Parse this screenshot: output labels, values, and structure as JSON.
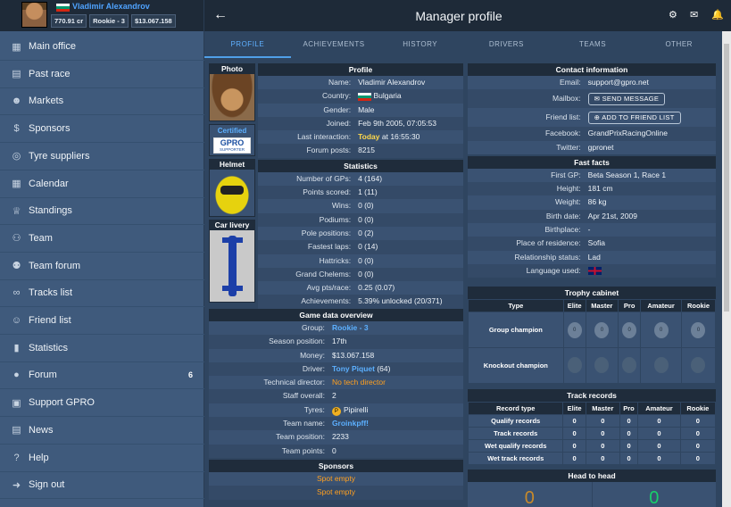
{
  "user": {
    "name": "Vladimir Alexandrov",
    "credits": "770.91 cr",
    "group": "Rookie - 3",
    "money": "$13.067.158"
  },
  "sidebar": {
    "items": [
      {
        "label": "Main office",
        "icon": "building-icon"
      },
      {
        "label": "Past race",
        "icon": "newspaper-icon"
      },
      {
        "label": "Markets",
        "icon": "users-icon"
      },
      {
        "label": "Sponsors",
        "icon": "dollar-icon"
      },
      {
        "label": "Tyre suppliers",
        "icon": "tyre-icon"
      },
      {
        "label": "Calendar",
        "icon": "calendar-icon"
      },
      {
        "label": "Standings",
        "icon": "trophy-icon"
      },
      {
        "label": "Team",
        "icon": "team-icon"
      },
      {
        "label": "Team forum",
        "icon": "team-forum-icon"
      },
      {
        "label": "Tracks list",
        "icon": "track-icon"
      },
      {
        "label": "Friend list",
        "icon": "friends-icon"
      },
      {
        "label": "Statistics",
        "icon": "bar-chart-icon"
      },
      {
        "label": "Forum",
        "icon": "forum-icon",
        "count": "6"
      },
      {
        "label": "Support GPRO",
        "icon": "support-icon"
      },
      {
        "label": "News",
        "icon": "news-icon"
      },
      {
        "label": "Help",
        "icon": "help-icon"
      },
      {
        "label": "Sign out",
        "icon": "signout-icon"
      }
    ]
  },
  "header": {
    "title": "Manager profile"
  },
  "tabs": [
    "PROFILE",
    "ACHIEVEMENTS",
    "HISTORY",
    "DRIVERS",
    "TEAMS",
    "OTHER"
  ],
  "photos": {
    "photo_label": "Photo",
    "certified": "Certified",
    "supporter": "GPRO",
    "supporter_sub": "SUPPORTER",
    "helmet_label": "Helmet",
    "livery_label": "Car livery"
  },
  "profile": {
    "title": "Profile",
    "rows": [
      {
        "label": "Name:",
        "value": "Vladimir Alexandrov"
      },
      {
        "label": "Country:",
        "value": "Bulgaria"
      },
      {
        "label": "Gender:",
        "value": "Male"
      },
      {
        "label": "Joined:",
        "value": "Feb 9th 2005, 07:05:53"
      },
      {
        "label": "Last interaction:",
        "value": "Today",
        "value2": "at 16:55:30"
      },
      {
        "label": "Forum posts:",
        "value": "8215"
      }
    ]
  },
  "statistics": {
    "title": "Statistics",
    "rows": [
      {
        "label": "Number of GPs:",
        "value": "4 (164)"
      },
      {
        "label": "Points scored:",
        "value": "1 (11)"
      },
      {
        "label": "Wins:",
        "value": "0 (0)"
      },
      {
        "label": "Podiums:",
        "value": "0 (0)"
      },
      {
        "label": "Pole positions:",
        "value": "0 (2)"
      },
      {
        "label": "Fastest laps:",
        "value": "0 (14)"
      },
      {
        "label": "Hattricks:",
        "value": "0 (0)"
      },
      {
        "label": "Grand Chelems:",
        "value": "0 (0)"
      },
      {
        "label": "Avg pts/race:",
        "value": "0.25 (0.07)"
      },
      {
        "label": "Achievements:",
        "value": "5.39% unlocked (20/371)"
      }
    ]
  },
  "game": {
    "title": "Game data overview",
    "rows": [
      {
        "label": "Group:",
        "value": "Rookie - 3"
      },
      {
        "label": "Season position:",
        "value": "17th"
      },
      {
        "label": "Money:",
        "value": "$13.067.158"
      },
      {
        "label": "Driver:",
        "value": "Tony Piquet",
        "value2": "(64)"
      },
      {
        "label": "Technical director:",
        "value": "No tech director"
      },
      {
        "label": "Staff overall:",
        "value": "2"
      },
      {
        "label": "Tyres:",
        "value": "Pipirelli"
      },
      {
        "label": "Team name:",
        "value": "Groinkpff!"
      },
      {
        "label": "Team position:",
        "value": "2233"
      },
      {
        "label": "Team points:",
        "value": "0"
      }
    ]
  },
  "sponsors": {
    "title": "Sponsors",
    "items": [
      "Spot empty",
      "Spot empty"
    ]
  },
  "contact": {
    "title": "Contact information",
    "email_label": "Email:",
    "email": "support@gpro.net",
    "mailbox_label": "Mailbox:",
    "send_message": "SEND MESSAGE",
    "friend_label": "Friend list:",
    "add_friend": "ADD TO FRIEND LIST",
    "facebook_label": "Facebook:",
    "facebook": "GrandPrixRacingOnline",
    "twitter_label": "Twitter:",
    "twitter": "gpronet"
  },
  "facts": {
    "title": "Fast facts",
    "rows": [
      {
        "label": "First GP:",
        "value": "Beta Season 1, Race 1"
      },
      {
        "label": "Height:",
        "value": "181 cm"
      },
      {
        "label": "Weight:",
        "value": "86 kg"
      },
      {
        "label": "Birth date:",
        "value": "Apr 21st, 2009"
      },
      {
        "label": "Birthplace:",
        "value": "-"
      },
      {
        "label": "Place of residence:",
        "value": "Sofia"
      },
      {
        "label": "Relationship status:",
        "value": "Lad"
      },
      {
        "label": "Language used:",
        "value": ""
      }
    ]
  },
  "trophy": {
    "title": "Trophy cabinet",
    "cols": [
      "Type",
      "Elite",
      "Master",
      "Pro",
      "Amateur",
      "Rookie"
    ],
    "rows": [
      "Group champion",
      "Knockout champion"
    ],
    "counts": [
      "0",
      "0",
      "0",
      "0",
      "0"
    ]
  },
  "tracks": {
    "title": "Track records",
    "cols": [
      "Record type",
      "Elite",
      "Master",
      "Pro",
      "Amateur",
      "Rookie"
    ],
    "rows": [
      {
        "label": "Qualify records",
        "vals": [
          "0",
          "0",
          "0",
          "0",
          "0"
        ]
      },
      {
        "label": "Track records",
        "vals": [
          "0",
          "0",
          "0",
          "0",
          "0"
        ]
      },
      {
        "label": "Wet qualify records",
        "vals": [
          "0",
          "0",
          "0",
          "0",
          "0"
        ]
      },
      {
        "label": "Wet track records",
        "vals": [
          "0",
          "0",
          "0",
          "0",
          "0"
        ]
      }
    ]
  },
  "h2h": {
    "title": "Head to head",
    "left": "0",
    "right": "0"
  }
}
